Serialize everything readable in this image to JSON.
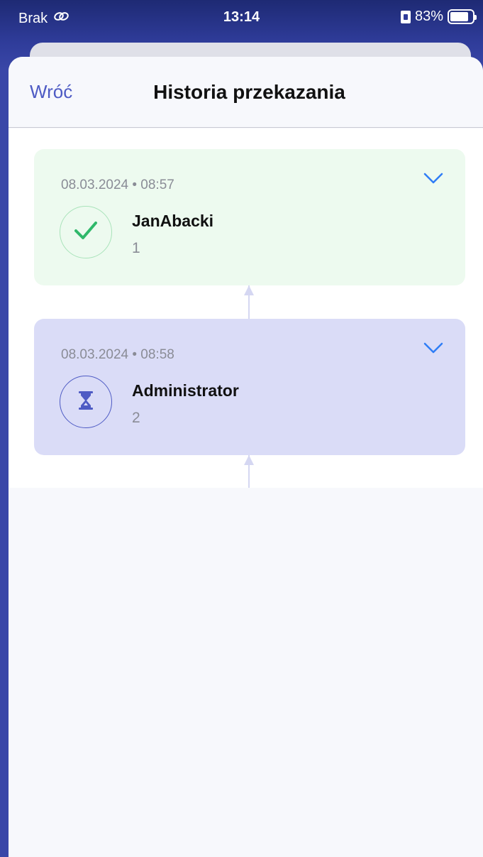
{
  "status_bar": {
    "carrier": "Brak",
    "time": "13:14",
    "battery_percent": "83%",
    "battery_level": 0.83
  },
  "nav": {
    "back_label": "Wróć",
    "title": "Historia przekazania"
  },
  "history": [
    {
      "datetime": "08.03.2024 • 08:57",
      "name": "JanAbacki",
      "step": "1",
      "status": "done",
      "icon": "checkmark-icon",
      "color": "#2fb86a"
    },
    {
      "datetime": "08.03.2024 • 08:58",
      "name": "Administrator",
      "step": "2",
      "status": "pending",
      "icon": "hourglass-icon",
      "color": "#4e5bc4"
    }
  ],
  "colors": {
    "accent": "#4e5bc4",
    "chevron": "#2f7df6",
    "done_bg": "#edfaef",
    "pending_bg": "#dadcf7"
  }
}
